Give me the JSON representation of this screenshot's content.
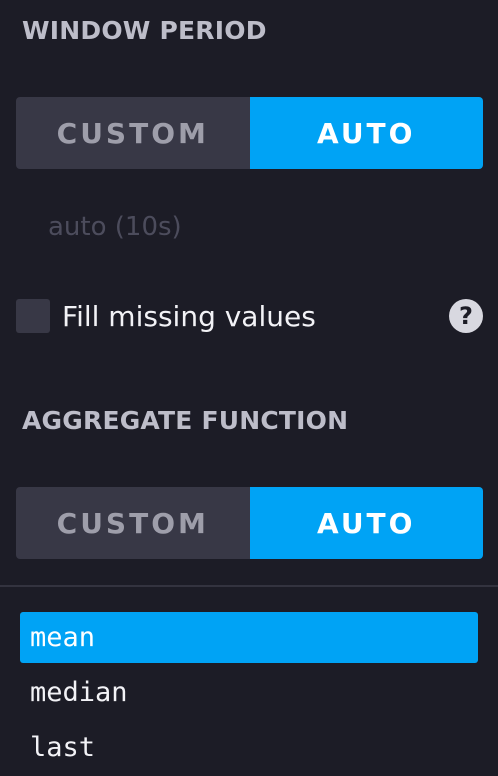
{
  "window_period": {
    "title": "WINDOW PERIOD",
    "custom_label": "CUSTOM",
    "auto_label": "AUTO",
    "selected": "AUTO",
    "auto_value": "auto (10s)"
  },
  "fill_missing": {
    "label": "Fill missing values",
    "checked": false,
    "help_icon": "question-circle-icon",
    "help_glyph": "?"
  },
  "aggregate_function": {
    "title": "AGGREGATE FUNCTION",
    "custom_label": "CUSTOM",
    "auto_label": "AUTO",
    "selected": "AUTO",
    "functions": [
      "mean",
      "median",
      "last"
    ],
    "selected_function": "mean"
  },
  "colors": {
    "background": "#1c1c26",
    "accent": "#00a3f5",
    "toggle_off": "#383846"
  }
}
